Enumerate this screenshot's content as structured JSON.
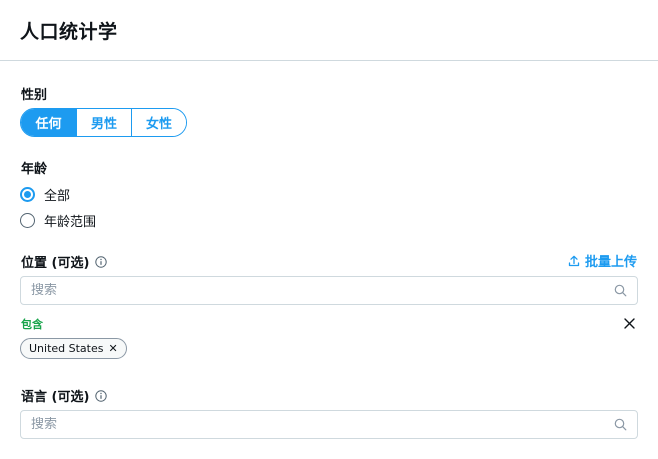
{
  "header": {
    "title": "人口统计学"
  },
  "gender": {
    "label": "性别",
    "options": [
      "任何",
      "男性",
      "女性"
    ],
    "selected": "任何"
  },
  "age": {
    "label": "年龄",
    "options": [
      "全部",
      "年龄范围"
    ],
    "selected": "全部"
  },
  "location": {
    "label": "位置 (可选)",
    "upload_label": "批量上传",
    "search_placeholder": "搜索",
    "include_label": "包含",
    "chips": [
      "United States"
    ]
  },
  "language": {
    "label": "语言 (可选)",
    "search_placeholder": "搜索"
  },
  "colors": {
    "accent": "#1d9bf0",
    "include": "#17a34a",
    "border": "#cfd9de"
  }
}
